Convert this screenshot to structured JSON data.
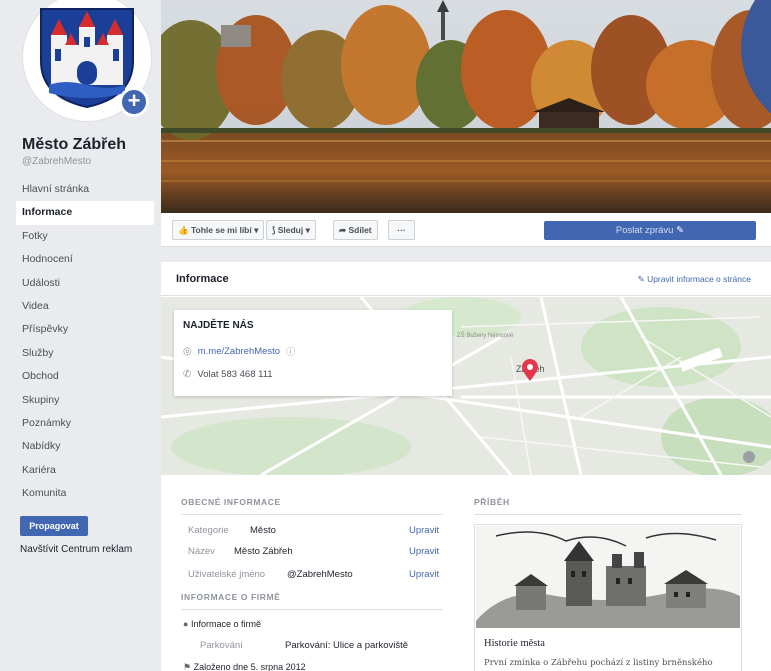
{
  "sidebar": {
    "page_name": "Město Zábřeh",
    "handle": "@ZabrehMesto",
    "items": [
      {
        "label": "Hlavní stránka",
        "active": false
      },
      {
        "label": "Informace",
        "active": true
      },
      {
        "label": "Fotky",
        "active": false
      },
      {
        "label": "Hodnocení",
        "active": false
      },
      {
        "label": "Události",
        "active": false
      },
      {
        "label": "Videa",
        "active": false
      },
      {
        "label": "Příspěvky",
        "active": false
      },
      {
        "label": "Služby",
        "active": false
      },
      {
        "label": "Obchod",
        "active": false
      },
      {
        "label": "Skupiny",
        "active": false
      },
      {
        "label": "Poznámky",
        "active": false
      },
      {
        "label": "Nabídky",
        "active": false
      },
      {
        "label": "Kariéra",
        "active": false
      },
      {
        "label": "Komunita",
        "active": false
      }
    ],
    "promote_label": "Propagovat",
    "ads_center_label": "Navštívit Centrum reklam"
  },
  "actions": {
    "like_label": "Tohle se mi líbí",
    "follow_label": "Sleduj",
    "share_label": "Sdílet",
    "more_label": "···",
    "send_message_label": "Poslat zprávu"
  },
  "info": {
    "title": "Informace",
    "edit_link": "Upravit informace o stránce",
    "find_us": {
      "title": "NAJDĚTE NÁS",
      "messenger_link": "m.me/ZabrehMesto",
      "phone": "Volat 583 468 111"
    },
    "map_labels": {
      "town": "Zábřeh",
      "area": "ZŠ Boženy Němcové"
    },
    "general": {
      "title": "OBECNÉ INFORMACE",
      "rows": [
        {
          "label": "Kategorie",
          "value": "Město",
          "edit": "Upravit"
        },
        {
          "label": "Název",
          "value": "Město Zábřeh",
          "edit": "Upravit"
        },
        {
          "label": "Uživatelské jméno",
          "value": "@ZabrehMesto",
          "edit": "Upravit"
        }
      ]
    },
    "company": {
      "title": "INFORMACE O FIRMĚ",
      "company_info": "Informace o firmě",
      "parking_label": "Parkování",
      "parking_value": "Parkování: Ulice a parkoviště",
      "founded": "Založeno dne 5. srpna 2012"
    },
    "story": {
      "title": "PŘÍBĚH",
      "heading": "Historie města",
      "text": "První zmínka o Zábřehu pochází z listiny brněnského"
    }
  },
  "colors": {
    "facebook_blue": "#4267b2",
    "fb_logo_bg": "#3b5998",
    "map_pin": "#e4364d"
  }
}
